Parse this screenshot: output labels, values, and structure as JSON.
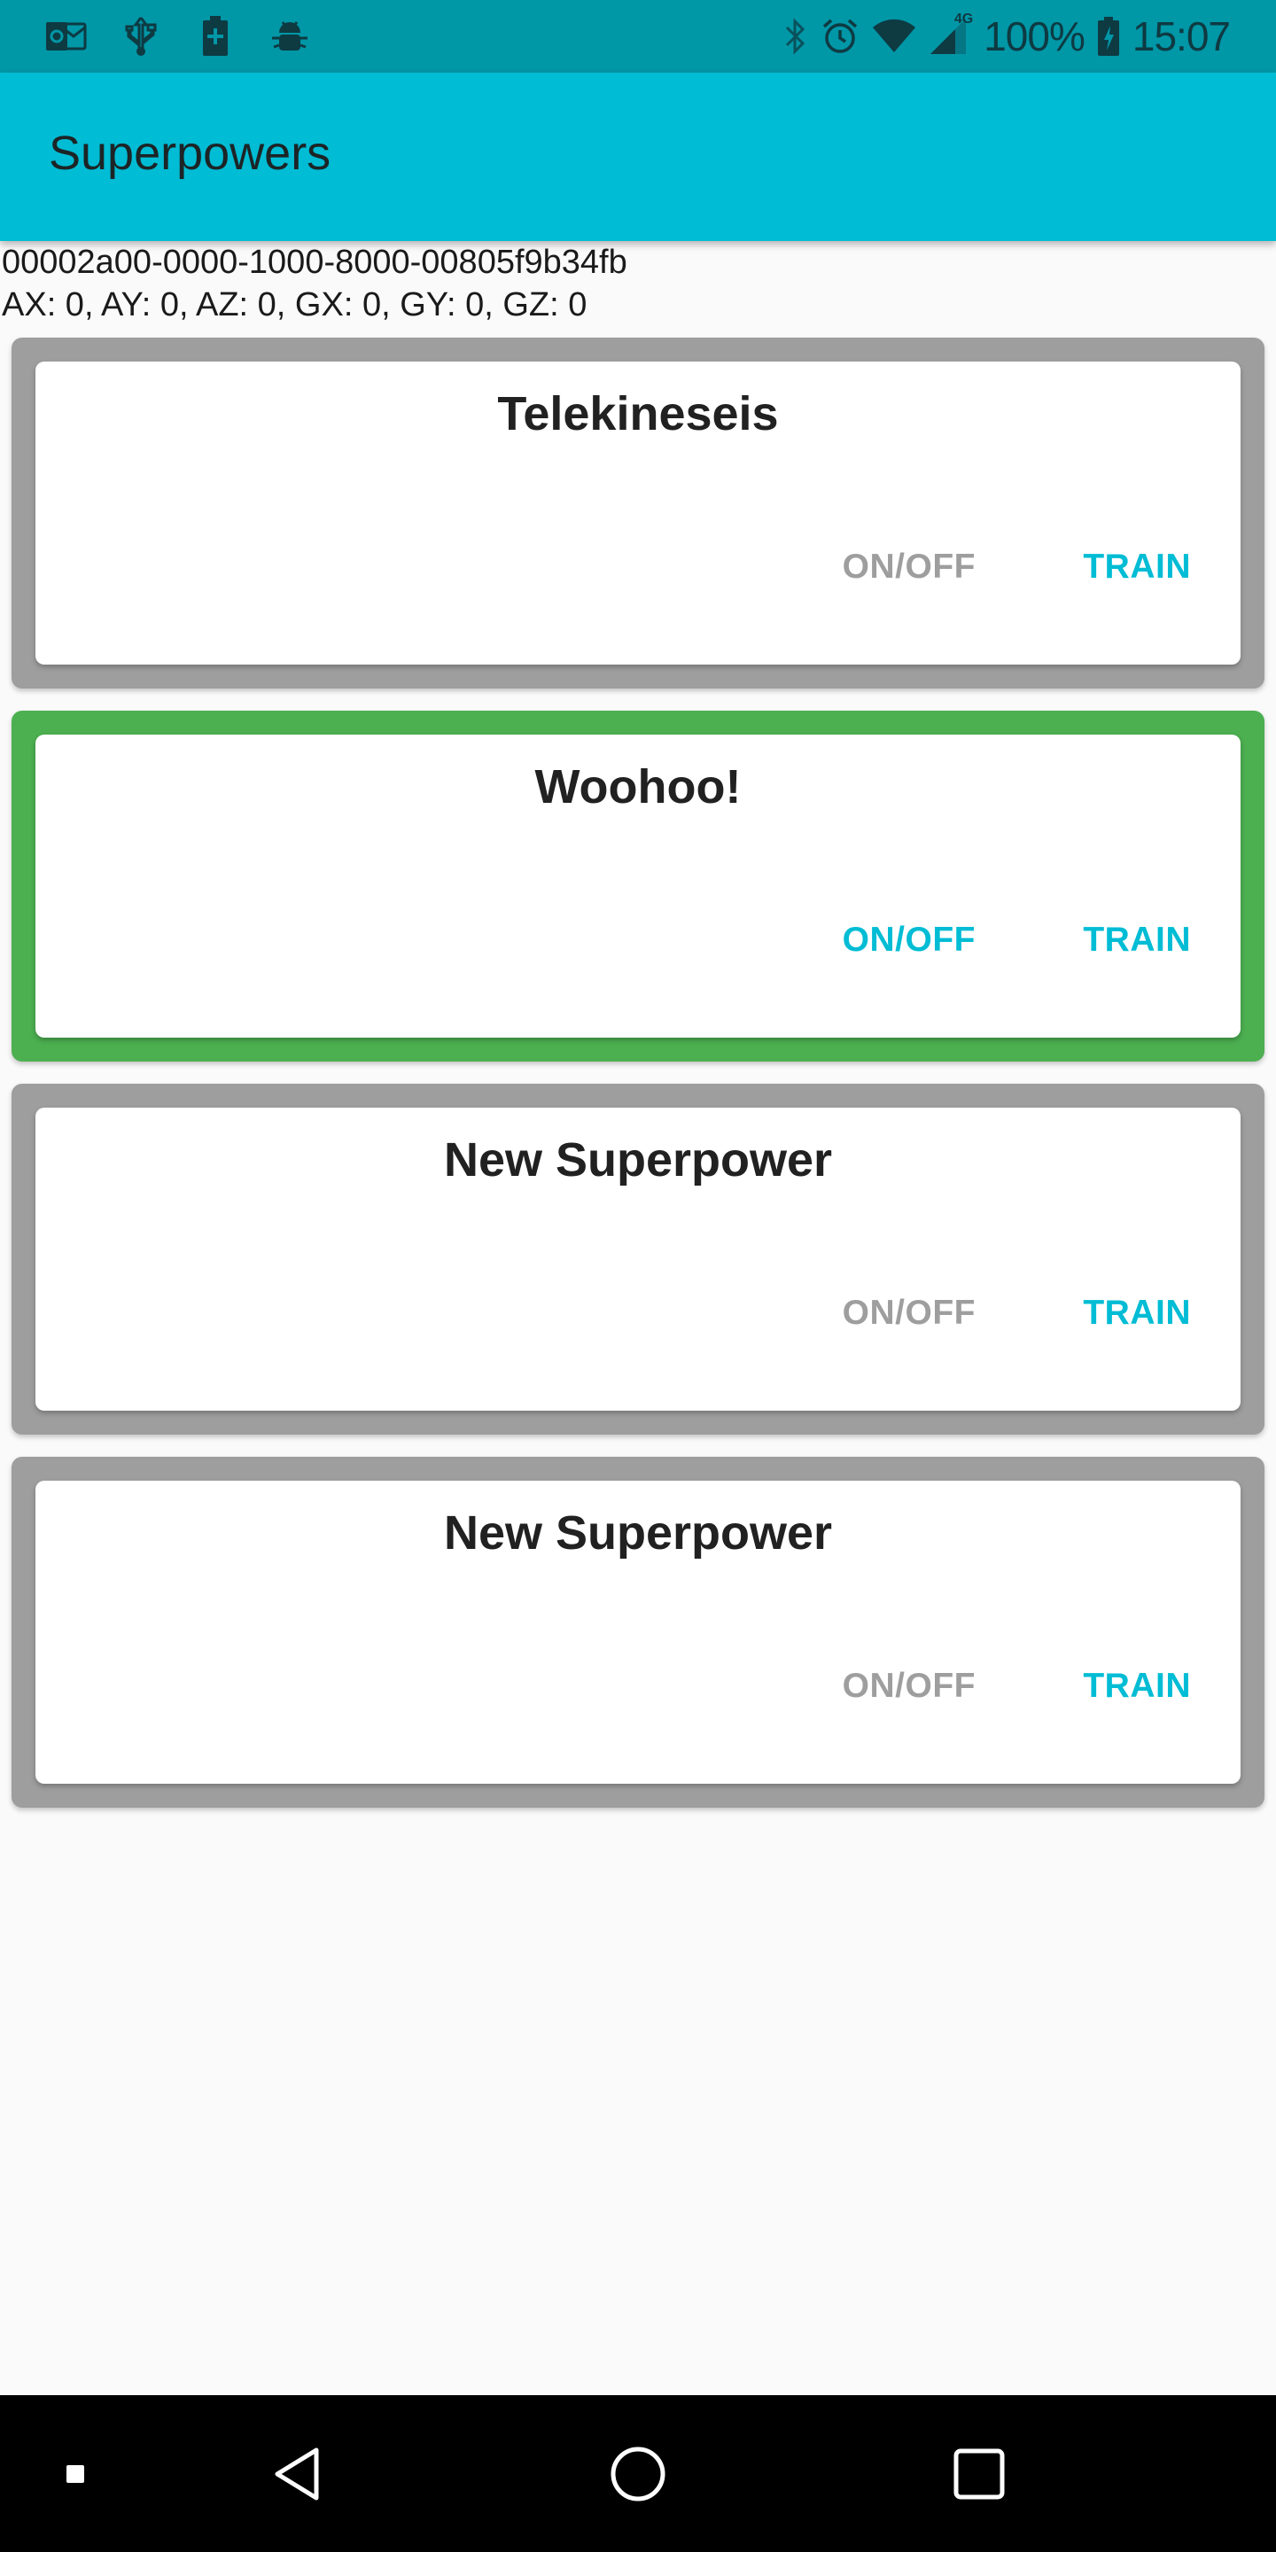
{
  "status_bar": {
    "left_icons": [
      "outlook-icon",
      "usb-icon",
      "battery-saver-icon",
      "android-debug-icon"
    ],
    "right_icons": [
      "bluetooth-icon",
      "alarm-icon",
      "wifi-icon",
      "cellular-4g-icon"
    ],
    "network_label": "4G",
    "battery_percent": "100%",
    "time": "15:07"
  },
  "app_bar": {
    "title": "Superpowers",
    "color": "#00bcd4"
  },
  "info": {
    "uuid": "00002a00-0000-1000-8000-00805f9b34fb",
    "sensors": "AX: 0, AY: 0, AZ: 0, GX: 0, GY: 0, GZ: 0"
  },
  "cards": [
    {
      "title": "Telekineseis",
      "active": false,
      "onoff_label": "ON/OFF",
      "train_label": "TRAIN"
    },
    {
      "title": "Woohoo!",
      "active": true,
      "onoff_label": "ON/OFF",
      "train_label": "TRAIN"
    },
    {
      "title": "New Superpower",
      "active": false,
      "onoff_label": "ON/OFF",
      "train_label": "TRAIN"
    },
    {
      "title": "New Superpower",
      "active": false,
      "onoff_label": "ON/OFF",
      "train_label": "TRAIN"
    }
  ],
  "colors": {
    "accent": "#00bcd4",
    "status_bar": "#0097a7",
    "inactive_frame": "#9e9e9e",
    "active_frame": "#4caf50",
    "disabled_button": "#9e9e9e"
  },
  "nav_bar": {
    "buttons": [
      "debug-square-icon",
      "back-icon",
      "home-icon",
      "recents-icon"
    ]
  }
}
